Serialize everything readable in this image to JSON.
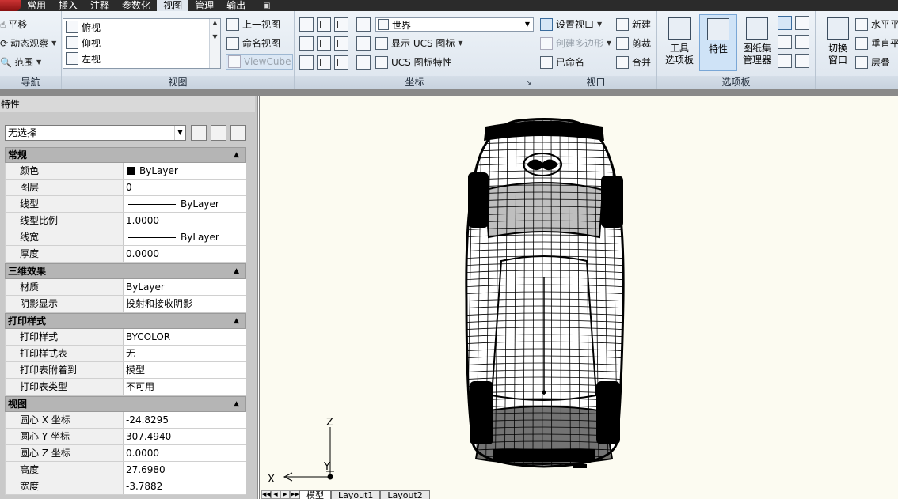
{
  "menu": [
    "常用",
    "插入",
    "注释",
    "参数化",
    "视图",
    "管理",
    "输出"
  ],
  "menu_active": "视图",
  "menu_extra": "▣",
  "ribbon": {
    "nav": {
      "title": "导航",
      "pan": "平移",
      "orbit": "动态观察",
      "extents": "范围"
    },
    "views": {
      "title": "视图",
      "list": [
        "俯视",
        "仰视",
        "左视"
      ],
      "prev_view": "上一视图",
      "named_view": "命名视图",
      "viewcube": "ViewCube"
    },
    "coords": {
      "title": "坐标",
      "ucs_world": "世界",
      "show_ucs_icon": "显示 UCS 图标",
      "ucs_icon_props": "UCS 图标特性"
    },
    "viewports": {
      "title": "视口",
      "set_viewport": "设置视口",
      "new": "新建",
      "create_polygon": "创建多边形",
      "clip": "剪裁",
      "named": "已命名",
      "join": "合并"
    },
    "palettes": {
      "title": "选项板",
      "tool_palettes_1": "工具",
      "tool_palettes_2": "选项板",
      "properties": "特性",
      "sheetset_1": "图纸集",
      "sheetset_2": "管理器"
    },
    "windows": {
      "switch_1": "切换",
      "switch_2": "窗口",
      "tile_h": "水平平",
      "tile_v": "垂直平",
      "cascade": "层叠"
    }
  },
  "palette": {
    "title": "特性",
    "selection": "无选择",
    "sections": [
      {
        "name": "常规",
        "rows": [
          {
            "name": "颜色",
            "value": "ByLayer",
            "kind": "color"
          },
          {
            "name": "图层",
            "value": "0"
          },
          {
            "name": "线型",
            "value": "ByLayer",
            "kind": "line"
          },
          {
            "name": "线型比例",
            "value": "1.0000"
          },
          {
            "name": "线宽",
            "value": "ByLayer",
            "kind": "line"
          },
          {
            "name": "厚度",
            "value": "0.0000"
          }
        ]
      },
      {
        "name": "三维效果",
        "rows": [
          {
            "name": "材质",
            "value": "ByLayer"
          },
          {
            "name": "阴影显示",
            "value": "投射和接收阴影"
          }
        ]
      },
      {
        "name": "打印样式",
        "rows": [
          {
            "name": "打印样式",
            "value": "BYCOLOR"
          },
          {
            "name": "打印样式表",
            "value": "无"
          },
          {
            "name": "打印表附着到",
            "value": "模型"
          },
          {
            "name": "打印表类型",
            "value": "不可用"
          }
        ]
      },
      {
        "name": "视图",
        "rows": [
          {
            "name": "圆心 X 坐标",
            "value": "-24.8295"
          },
          {
            "name": "圆心 Y 坐标",
            "value": "307.4940"
          },
          {
            "name": "圆心 Z 坐标",
            "value": "0.0000"
          },
          {
            "name": "高度",
            "value": "27.6980"
          },
          {
            "name": "宽度",
            "value": "-3.7882"
          }
        ]
      }
    ]
  },
  "axes": {
    "x": "X",
    "y": "Y",
    "z": "Z"
  },
  "layout_tabs": [
    "模型",
    "Layout1",
    "Layout2"
  ]
}
